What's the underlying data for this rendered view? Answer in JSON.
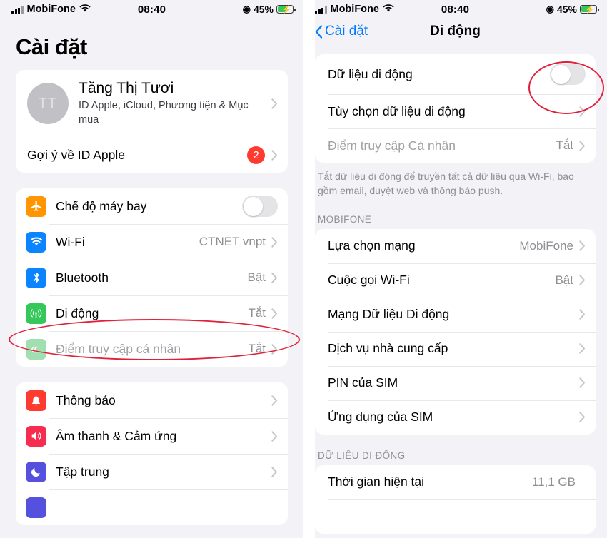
{
  "status_bar": {
    "carrier": "MobiFone",
    "time": "08:40",
    "battery_pct": "45%",
    "wifi_icon": "wifi-icon",
    "signal_icon": "signal-bars-icon",
    "location_icon": "location-arrow-icon",
    "battery_icon": "battery-charging-icon"
  },
  "left": {
    "title": "Cài đặt",
    "account": {
      "initials": "TT",
      "name": "Tăng Thị Tươi",
      "subtitle": "ID Apple, iCloud, Phương tiện & Mục mua"
    },
    "suggestion": {
      "label": "Gợi ý về ID Apple",
      "badge": "2"
    },
    "group_connectivity": [
      {
        "label": "Chế độ máy bay",
        "icon": "airplane-icon",
        "type": "toggle",
        "value": ""
      },
      {
        "label": "Wi-Fi",
        "icon": "wifi-icon",
        "type": "value",
        "value": "CTNET vnpt"
      },
      {
        "label": "Bluetooth",
        "icon": "bluetooth-icon",
        "type": "value",
        "value": "Bật"
      },
      {
        "label": "Di động",
        "icon": "cellular-icon",
        "type": "value",
        "value": "Tắt"
      },
      {
        "label": "Điểm truy cập cá nhân",
        "icon": "hotspot-icon",
        "type": "value",
        "value": "Tắt",
        "dim": true
      }
    ],
    "group_system": [
      {
        "label": "Thông báo",
        "icon": "bell-icon"
      },
      {
        "label": "Âm thanh & Cảm ứng",
        "icon": "speaker-icon"
      },
      {
        "label": "Tập trung",
        "icon": "moon-icon"
      }
    ]
  },
  "right": {
    "back_label": "Cài đặt",
    "title": "Di động",
    "group_primary": [
      {
        "label": "Dữ liệu di động",
        "type": "toggle",
        "value": ""
      },
      {
        "label": "Tùy chọn dữ liệu di động",
        "type": "chevron",
        "value": ""
      },
      {
        "label": "Điểm truy cập Cá nhân",
        "type": "value",
        "value": "Tắt",
        "dim": true
      }
    ],
    "footnote": "Tắt dữ liệu di động để truyền tất cả dữ liệu qua Wi-Fi, bao gồm email, duyệt web và thông báo push.",
    "carrier_header": "MOBIFONE",
    "group_carrier": [
      {
        "label": "Lựa chọn mạng",
        "value": "MobiFone"
      },
      {
        "label": "Cuộc gọi Wi-Fi",
        "value": "Bật"
      },
      {
        "label": "Mạng Dữ liệu Di động",
        "value": ""
      },
      {
        "label": "Dịch vụ nhà cung cấp",
        "value": ""
      },
      {
        "label": "PIN của SIM",
        "value": ""
      },
      {
        "label": "Ứng dụng của SIM",
        "value": ""
      }
    ],
    "data_header": "DỮ LIỆU DI ĐỘNG",
    "group_data": [
      {
        "label": "Thời gian hiện tại",
        "value": "11,1 GB"
      }
    ]
  },
  "annotations": {
    "highlight_color": "#e0203a",
    "left_ellipse_target": "Di động",
    "right_ellipse_target": "Dữ liệu di động toggle"
  },
  "colors": {
    "accent": "#007aff",
    "badge_red": "#ff3b30",
    "page_bg": "#f2f2f7",
    "card_bg": "#ffffff",
    "secondary_text": "#8e8e93",
    "battery_green": "#34c759"
  }
}
